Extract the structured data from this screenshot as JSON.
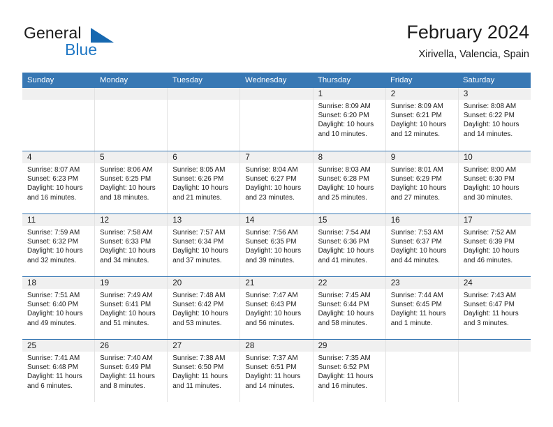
{
  "brand": {
    "name_part1": "General",
    "name_part2": "Blue",
    "triangle_color": "#1668b0",
    "blue_color": "#1f77c4"
  },
  "header": {
    "title": "February 2024",
    "location": "Xirivella, Valencia, Spain"
  },
  "theme": {
    "header_bar": "#3878b4",
    "day_number_band": "#f0f0f0",
    "cell_border": "#e2e2e2",
    "text": "#1c1c1c"
  },
  "weekdays": [
    "Sunday",
    "Monday",
    "Tuesday",
    "Wednesday",
    "Thursday",
    "Friday",
    "Saturday"
  ],
  "weeks": [
    [
      {
        "day": "",
        "empty": true
      },
      {
        "day": "",
        "empty": true
      },
      {
        "day": "",
        "empty": true
      },
      {
        "day": "",
        "empty": true
      },
      {
        "day": "1",
        "sunrise": "Sunrise: 8:09 AM",
        "sunset": "Sunset: 6:20 PM",
        "daylight1": "Daylight: 10 hours",
        "daylight2": "and 10 minutes."
      },
      {
        "day": "2",
        "sunrise": "Sunrise: 8:09 AM",
        "sunset": "Sunset: 6:21 PM",
        "daylight1": "Daylight: 10 hours",
        "daylight2": "and 12 minutes."
      },
      {
        "day": "3",
        "sunrise": "Sunrise: 8:08 AM",
        "sunset": "Sunset: 6:22 PM",
        "daylight1": "Daylight: 10 hours",
        "daylight2": "and 14 minutes."
      }
    ],
    [
      {
        "day": "4",
        "sunrise": "Sunrise: 8:07 AM",
        "sunset": "Sunset: 6:23 PM",
        "daylight1": "Daylight: 10 hours",
        "daylight2": "and 16 minutes."
      },
      {
        "day": "5",
        "sunrise": "Sunrise: 8:06 AM",
        "sunset": "Sunset: 6:25 PM",
        "daylight1": "Daylight: 10 hours",
        "daylight2": "and 18 minutes."
      },
      {
        "day": "6",
        "sunrise": "Sunrise: 8:05 AM",
        "sunset": "Sunset: 6:26 PM",
        "daylight1": "Daylight: 10 hours",
        "daylight2": "and 21 minutes."
      },
      {
        "day": "7",
        "sunrise": "Sunrise: 8:04 AM",
        "sunset": "Sunset: 6:27 PM",
        "daylight1": "Daylight: 10 hours",
        "daylight2": "and 23 minutes."
      },
      {
        "day": "8",
        "sunrise": "Sunrise: 8:03 AM",
        "sunset": "Sunset: 6:28 PM",
        "daylight1": "Daylight: 10 hours",
        "daylight2": "and 25 minutes."
      },
      {
        "day": "9",
        "sunrise": "Sunrise: 8:01 AM",
        "sunset": "Sunset: 6:29 PM",
        "daylight1": "Daylight: 10 hours",
        "daylight2": "and 27 minutes."
      },
      {
        "day": "10",
        "sunrise": "Sunrise: 8:00 AM",
        "sunset": "Sunset: 6:30 PM",
        "daylight1": "Daylight: 10 hours",
        "daylight2": "and 30 minutes."
      }
    ],
    [
      {
        "day": "11",
        "sunrise": "Sunrise: 7:59 AM",
        "sunset": "Sunset: 6:32 PM",
        "daylight1": "Daylight: 10 hours",
        "daylight2": "and 32 minutes."
      },
      {
        "day": "12",
        "sunrise": "Sunrise: 7:58 AM",
        "sunset": "Sunset: 6:33 PM",
        "daylight1": "Daylight: 10 hours",
        "daylight2": "and 34 minutes."
      },
      {
        "day": "13",
        "sunrise": "Sunrise: 7:57 AM",
        "sunset": "Sunset: 6:34 PM",
        "daylight1": "Daylight: 10 hours",
        "daylight2": "and 37 minutes."
      },
      {
        "day": "14",
        "sunrise": "Sunrise: 7:56 AM",
        "sunset": "Sunset: 6:35 PM",
        "daylight1": "Daylight: 10 hours",
        "daylight2": "and 39 minutes."
      },
      {
        "day": "15",
        "sunrise": "Sunrise: 7:54 AM",
        "sunset": "Sunset: 6:36 PM",
        "daylight1": "Daylight: 10 hours",
        "daylight2": "and 41 minutes."
      },
      {
        "day": "16",
        "sunrise": "Sunrise: 7:53 AM",
        "sunset": "Sunset: 6:37 PM",
        "daylight1": "Daylight: 10 hours",
        "daylight2": "and 44 minutes."
      },
      {
        "day": "17",
        "sunrise": "Sunrise: 7:52 AM",
        "sunset": "Sunset: 6:39 PM",
        "daylight1": "Daylight: 10 hours",
        "daylight2": "and 46 minutes."
      }
    ],
    [
      {
        "day": "18",
        "sunrise": "Sunrise: 7:51 AM",
        "sunset": "Sunset: 6:40 PM",
        "daylight1": "Daylight: 10 hours",
        "daylight2": "and 49 minutes."
      },
      {
        "day": "19",
        "sunrise": "Sunrise: 7:49 AM",
        "sunset": "Sunset: 6:41 PM",
        "daylight1": "Daylight: 10 hours",
        "daylight2": "and 51 minutes."
      },
      {
        "day": "20",
        "sunrise": "Sunrise: 7:48 AM",
        "sunset": "Sunset: 6:42 PM",
        "daylight1": "Daylight: 10 hours",
        "daylight2": "and 53 minutes."
      },
      {
        "day": "21",
        "sunrise": "Sunrise: 7:47 AM",
        "sunset": "Sunset: 6:43 PM",
        "daylight1": "Daylight: 10 hours",
        "daylight2": "and 56 minutes."
      },
      {
        "day": "22",
        "sunrise": "Sunrise: 7:45 AM",
        "sunset": "Sunset: 6:44 PM",
        "daylight1": "Daylight: 10 hours",
        "daylight2": "and 58 minutes."
      },
      {
        "day": "23",
        "sunrise": "Sunrise: 7:44 AM",
        "sunset": "Sunset: 6:45 PM",
        "daylight1": "Daylight: 11 hours",
        "daylight2": "and 1 minute."
      },
      {
        "day": "24",
        "sunrise": "Sunrise: 7:43 AM",
        "sunset": "Sunset: 6:47 PM",
        "daylight1": "Daylight: 11 hours",
        "daylight2": "and 3 minutes."
      }
    ],
    [
      {
        "day": "25",
        "sunrise": "Sunrise: 7:41 AM",
        "sunset": "Sunset: 6:48 PM",
        "daylight1": "Daylight: 11 hours",
        "daylight2": "and 6 minutes."
      },
      {
        "day": "26",
        "sunrise": "Sunrise: 7:40 AM",
        "sunset": "Sunset: 6:49 PM",
        "daylight1": "Daylight: 11 hours",
        "daylight2": "and 8 minutes."
      },
      {
        "day": "27",
        "sunrise": "Sunrise: 7:38 AM",
        "sunset": "Sunset: 6:50 PM",
        "daylight1": "Daylight: 11 hours",
        "daylight2": "and 11 minutes."
      },
      {
        "day": "28",
        "sunrise": "Sunrise: 7:37 AM",
        "sunset": "Sunset: 6:51 PM",
        "daylight1": "Daylight: 11 hours",
        "daylight2": "and 14 minutes."
      },
      {
        "day": "29",
        "sunrise": "Sunrise: 7:35 AM",
        "sunset": "Sunset: 6:52 PM",
        "daylight1": "Daylight: 11 hours",
        "daylight2": "and 16 minutes."
      },
      {
        "day": "",
        "empty": true
      },
      {
        "day": "",
        "empty": true
      }
    ]
  ]
}
